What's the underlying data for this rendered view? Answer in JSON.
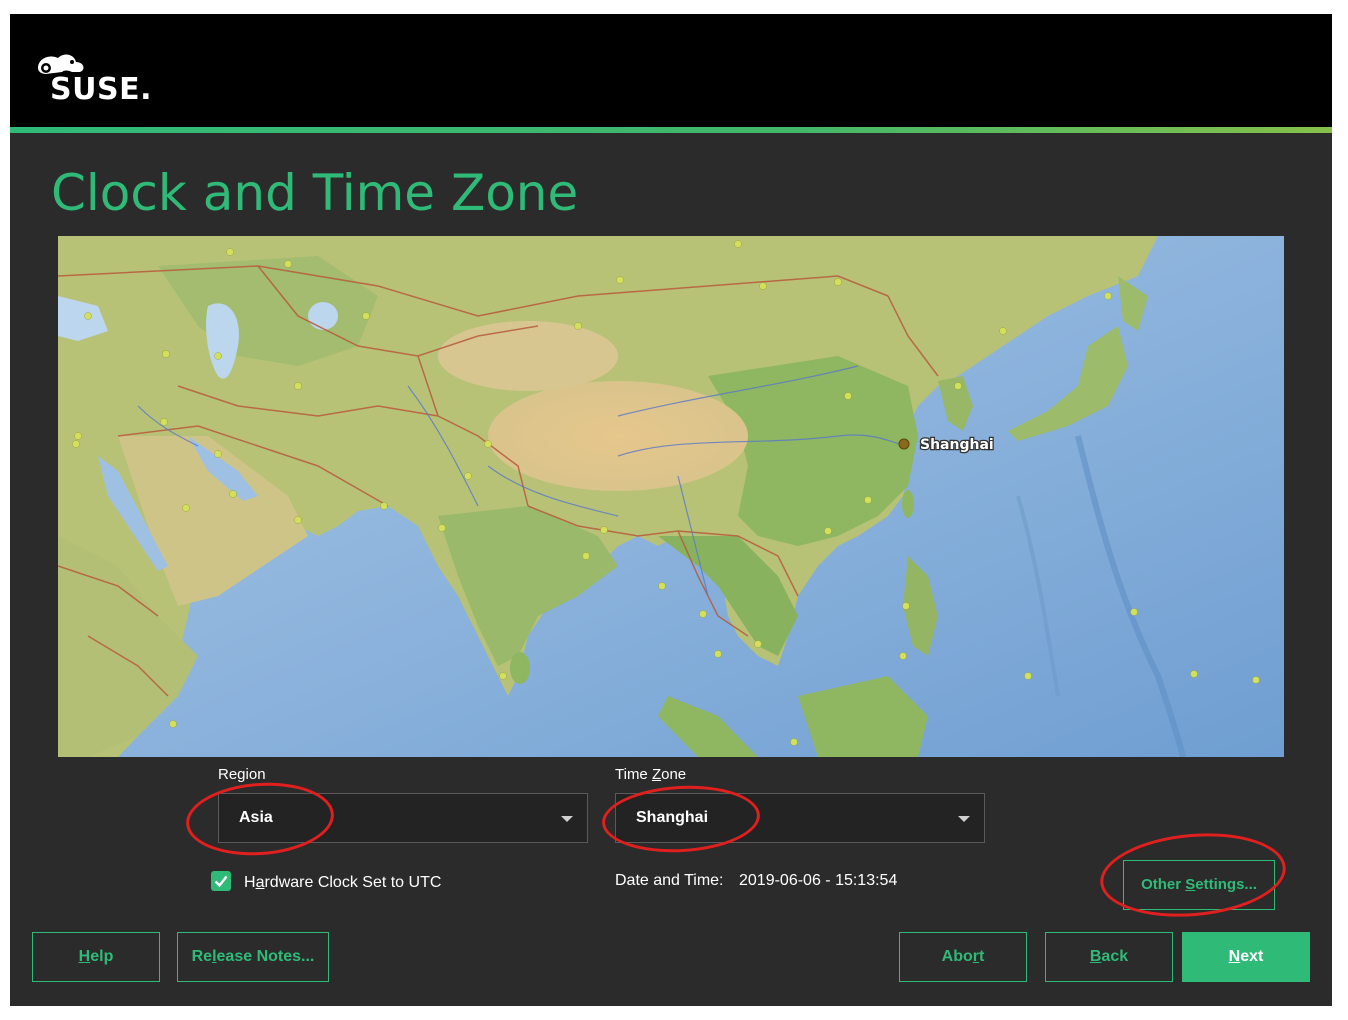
{
  "brand": {
    "logo_text": "SUSE.",
    "accent": "#30ba78"
  },
  "page": {
    "title": "Clock and Time Zone"
  },
  "map": {
    "selected_city": "Shanghai"
  },
  "region": {
    "label_pre": "Region",
    "value": "Asia"
  },
  "timezone": {
    "label_pre": "Time ",
    "label_key": "Z",
    "label_post": "one",
    "value": "Shanghai"
  },
  "hwclock": {
    "checked": true,
    "label_pre": "H",
    "label_key": "a",
    "label_post": "rdware Clock Set to UTC"
  },
  "datetime": {
    "label": "Date and Time:",
    "value": "2019-06-06 - 15:13:54"
  },
  "other_settings": {
    "pre": "Other ",
    "key": "S",
    "post": "ettings..."
  },
  "buttons": {
    "help": {
      "key": "H",
      "post": "elp"
    },
    "release_notes": {
      "pre": "Re",
      "key": "l",
      "post": "ease Notes..."
    },
    "abort": {
      "pre": "Abo",
      "key": "r",
      "post": "t"
    },
    "back": {
      "key": "B",
      "post": "ack"
    },
    "next": {
      "key": "N",
      "post": "ext"
    }
  },
  "annotation_color": "#e0201e"
}
